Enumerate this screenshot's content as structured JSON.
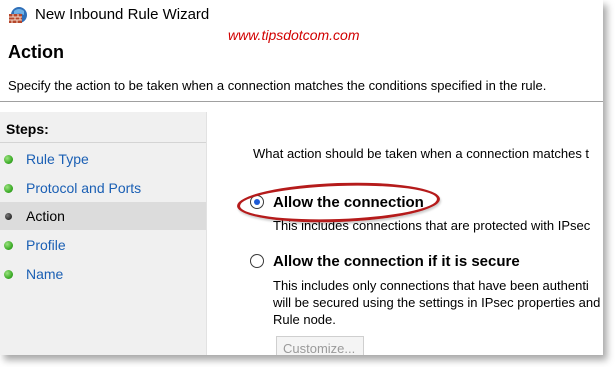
{
  "window": {
    "title": "New Inbound Rule Wizard",
    "icon": "firewall-brick-icon"
  },
  "watermark": "www.tipsdotcom.com",
  "header": {
    "title": "Action",
    "description": "Specify the action to be taken when a connection matches the conditions specified in the rule."
  },
  "steps": {
    "heading": "Steps:",
    "items": [
      {
        "label": "Rule Type",
        "state": "done"
      },
      {
        "label": "Protocol and Ports",
        "state": "done"
      },
      {
        "label": "Action",
        "state": "current"
      },
      {
        "label": "Profile",
        "state": "done"
      },
      {
        "label": "Name",
        "state": "done"
      }
    ]
  },
  "main": {
    "question": "What action should be taken when a connection matches t",
    "options": [
      {
        "label": "Allow the connection",
        "selected": true,
        "description": [
          "This includes connections that are protected with IPsec"
        ]
      },
      {
        "label": "Allow the connection if it is secure",
        "selected": false,
        "description": [
          "This includes only connections that have been authenti",
          "will be secured using the settings in IPsec properties and",
          "Rule node."
        ]
      }
    ],
    "customize_label": "Customize..."
  },
  "colors": {
    "highlight_ellipse": "#b51b1b",
    "watermark": "#d10000",
    "link": "#1a5fb4",
    "radio_dot": "#1e5ad6"
  }
}
